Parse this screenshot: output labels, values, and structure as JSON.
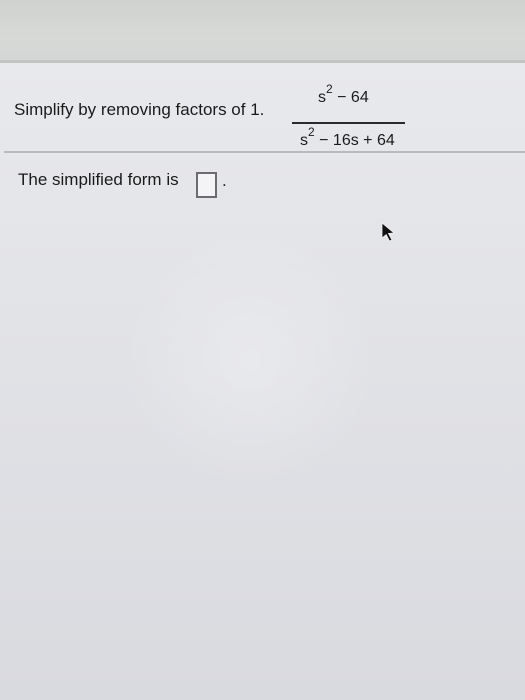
{
  "question": {
    "prompt": "Simplify by removing factors of 1."
  },
  "expression": {
    "numerator": {
      "base": "s",
      "exponent": "2",
      "rest": " − 64"
    },
    "denominator": {
      "base": "s",
      "exponent": "2",
      "rest": " − 16s + 64"
    }
  },
  "answer": {
    "label": "The simplified form is",
    "period": "."
  },
  "icons": {
    "cursor": "mouse-pointer-icon"
  }
}
